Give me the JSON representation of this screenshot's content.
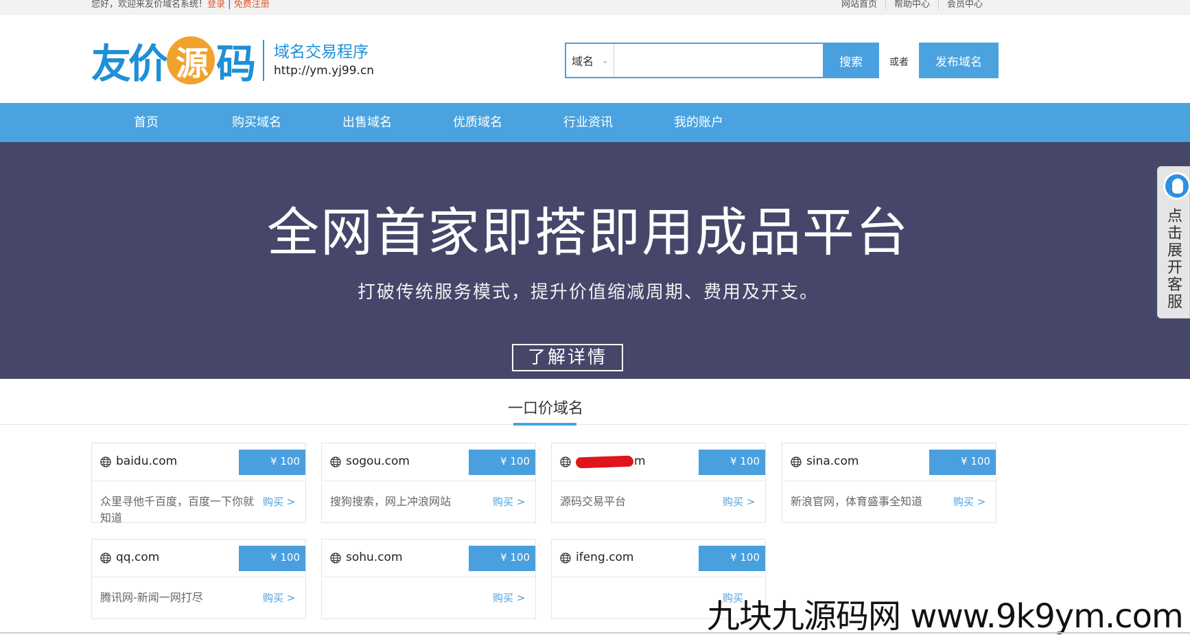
{
  "topbar": {
    "welcome": "您好，欢迎来友价域名系统！",
    "login": "登录",
    "sep": " | ",
    "register": "免费注册",
    "links": [
      "网站首页",
      "帮助中心",
      "会员中心"
    ]
  },
  "header": {
    "logo_text_a": "友价",
    "logo_text_b": "源",
    "logo_text_c": "码",
    "tagline": "域名交易程序",
    "url": "http://ym.yj99.cn",
    "search_select": "域名",
    "search_placeholder": "",
    "search_button": "搜索",
    "or": "或者",
    "publish_button": "发布域名"
  },
  "nav": [
    "首页",
    "购买域名",
    "出售域名",
    "优质域名",
    "行业资讯",
    "我的账户"
  ],
  "banner": {
    "title": "全网首家即搭即用成品平台",
    "subtitle": "打破传统服务模式，提升价值缩减周期、费用及开支。",
    "more_button": "了解详情"
  },
  "section": {
    "title": "一口价域名"
  },
  "cards": [
    {
      "domain": "baidu.com",
      "price": "¥ 100",
      "desc": "众里寻他千百度，百度一下你就知道",
      "buy": "购买 >"
    },
    {
      "domain": "sogou.com",
      "price": "¥ 100",
      "desc": "搜狗搜索，网上冲浪网站",
      "buy": "购买 >"
    },
    {
      "domain": "m",
      "price": "¥ 100",
      "desc": "源码交易平台",
      "buy": "购买 >"
    },
    {
      "domain": "sina.com",
      "price": "¥ 100",
      "desc": "新浪官网，体育盛事全知道",
      "buy": "购买 >"
    },
    {
      "domain": "qq.com",
      "price": "¥ 100",
      "desc": "腾讯网-新闻一网打尽",
      "buy": "购买 >"
    },
    {
      "domain": "sohu.com",
      "price": "¥ 100",
      "desc": "",
      "buy": "购买 >"
    },
    {
      "domain": "ifeng.com",
      "price": "¥ 100",
      "desc": "",
      "buy": "购买"
    }
  ],
  "side_tab": {
    "label": "点击展开客服"
  },
  "watermark": "九块九源码网 www.9k9ym.com",
  "colors": {
    "accent": "#4aa3df",
    "banner_bg": "#46466a",
    "login_link": "#e2562c"
  }
}
